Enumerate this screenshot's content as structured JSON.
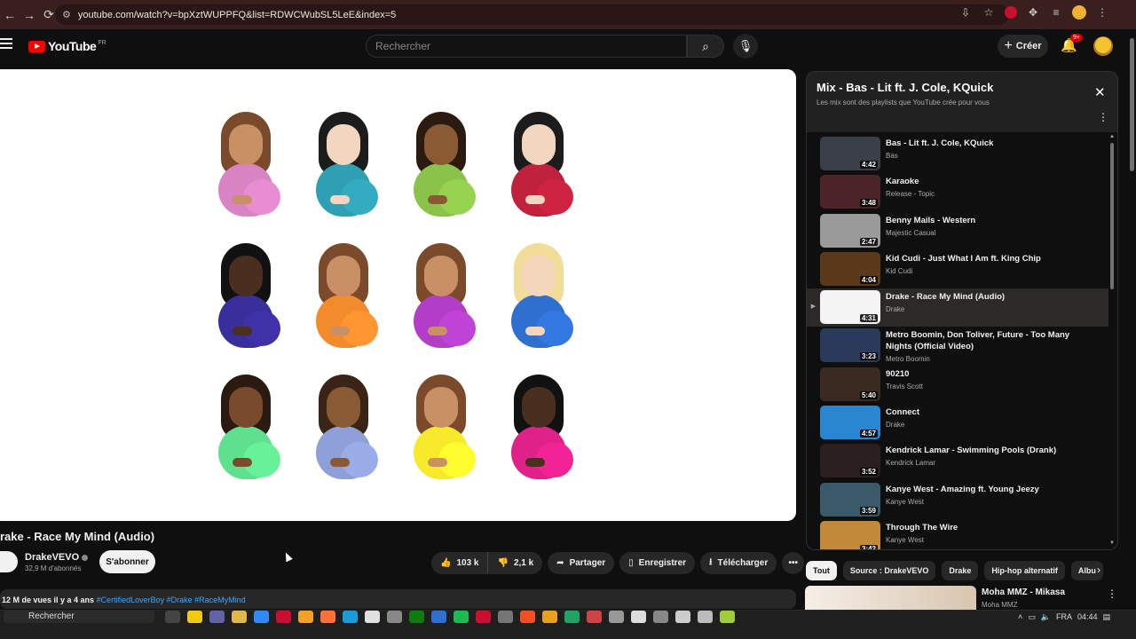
{
  "browser": {
    "url": "youtube.com/watch?v=bpXztWUPPFQ&list=RDWCWubSL5LeE&index=5"
  },
  "header": {
    "logo_text": "YouTube",
    "logo_country": "FR",
    "search_placeholder": "Rechercher",
    "create_label": "Créer",
    "notification_count": "9+"
  },
  "video": {
    "title": "rake - Race My Mind (Audio)",
    "channel": "DrakeVEVO",
    "subscribers": "32,9 M d'abonnés",
    "subscribe_label": "S'abonner",
    "likes": "103 k",
    "dislikes": "2,1 k",
    "share_label": "Partager",
    "save_label": "Enregistrer",
    "download_label": "Télécharger",
    "views_meta": "12 M de vues  il y a 4 ans",
    "hashtags": "#CertifiedLoverBoy #Drake #RaceMyMind"
  },
  "emoji_palette": [
    {
      "hair": "#7a4a2a",
      "skin": "#c99066",
      "shirt": "#d883c2"
    },
    {
      "hair": "#1c1c1c",
      "skin": "#f2d6bf",
      "shirt": "#2f9fb4"
    },
    {
      "hair": "#2b1a10",
      "skin": "#8a5a34",
      "shirt": "#8bc34a"
    },
    {
      "hair": "#1c1c1c",
      "skin": "#f2d6bf",
      "shirt": "#c0213c"
    },
    {
      "hair": "#111111",
      "skin": "#4a2f20",
      "shirt": "#3a2d9c"
    },
    {
      "hair": "#7a4a2a",
      "skin": "#c99066",
      "shirt": "#f28b2c"
    },
    {
      "hair": "#7a4a2a",
      "skin": "#c99066",
      "shirt": "#b23ec8"
    },
    {
      "hair": "#f1dc98",
      "skin": "#f4d6bd",
      "shirt": "#2f6fd0"
    },
    {
      "hair": "#2b1a10",
      "skin": "#7a4a2c",
      "shirt": "#5fe08e"
    },
    {
      "hair": "#3a2416",
      "skin": "#8a5a34",
      "shirt": "#8fa0d8"
    },
    {
      "hair": "#7a4a2a",
      "skin": "#c99066",
      "shirt": "#f6ea2a"
    },
    {
      "hair": "#111111",
      "skin": "#4a2f20",
      "shirt": "#e0218a"
    }
  ],
  "playlist": {
    "title": "Mix - Bas - Lit ft. J. Cole, KQuick",
    "subtitle": "Les mix sont des playlists que YouTube crée pour vous",
    "items": [
      {
        "title": "Bas - Lit ft. J. Cole, KQuick",
        "channel": "Bas",
        "duration": "4:42",
        "thumb": "#3b3f4a"
      },
      {
        "title": "Karaoke",
        "channel": "Release - Topic",
        "duration": "3:48",
        "thumb": "#4a2426"
      },
      {
        "title": "Benny Mails - Western",
        "channel": "Majestic Casual",
        "duration": "2:47",
        "thumb": "#9a9a9a"
      },
      {
        "title": "Kid Cudi - Just What I Am ft. King Chip",
        "channel": "Kid Cudi",
        "duration": "4:04",
        "thumb": "#5a3a1a"
      },
      {
        "title": "Drake - Race My Mind (Audio)",
        "channel": "Drake",
        "duration": "4:31",
        "thumb": "#f4f4f4"
      },
      {
        "title": "Metro Boomin, Don Toliver, Future - Too Many Nights (Official Video)",
        "channel": "Metro Boomin",
        "duration": "3:23",
        "thumb": "#2a3a5a"
      },
      {
        "title": "90210",
        "channel": "Travis Scott",
        "duration": "5:40",
        "thumb": "#3a2a22"
      },
      {
        "title": "Connect",
        "channel": "Drake",
        "duration": "4:57",
        "thumb": "#2a86d0"
      },
      {
        "title": "Kendrick Lamar - Swimming Pools (Drank)",
        "channel": "Kendrick Lamar",
        "duration": "3:52",
        "thumb": "#2a1e1e"
      },
      {
        "title": "Kanye West - Amazing ft. Young Jeezy",
        "channel": "Kanye West",
        "duration": "3:59",
        "thumb": "#3a5a6a"
      },
      {
        "title": "Through The Wire",
        "channel": "Kanye West",
        "duration": "3:42",
        "thumb": "#c08a3a"
      }
    ]
  },
  "chips": [
    "Tout",
    "Source : DrakeVEVO",
    "Drake",
    "Hip-hop alternatif",
    "Albu"
  ],
  "recommendation": {
    "title": "Moha MMZ - Mikasa",
    "channel": "Moha MMZ"
  },
  "taskbar": {
    "search_label": "Rechercher",
    "language": "FRA",
    "time": "04:44",
    "apps": [
      "#444",
      "#f2c811",
      "#6264a7",
      "#e1b64a",
      "#2f8af5",
      "#c8102e",
      "#f2a02a",
      "#ff7139",
      "#1a9bd7",
      "#e0e0e0",
      "#888",
      "#107c10",
      "#2f6fd0",
      "#1db954",
      "#c8102e",
      "#777",
      "#f25022",
      "#e8a020",
      "#21a366",
      "#cc4444",
      "#999",
      "#ddd",
      "#888",
      "#ccc",
      "#bbb",
      "#9fce3a"
    ]
  },
  "colors": {
    "accent_red": "#ff0000",
    "link_blue": "#3ea6ff"
  }
}
